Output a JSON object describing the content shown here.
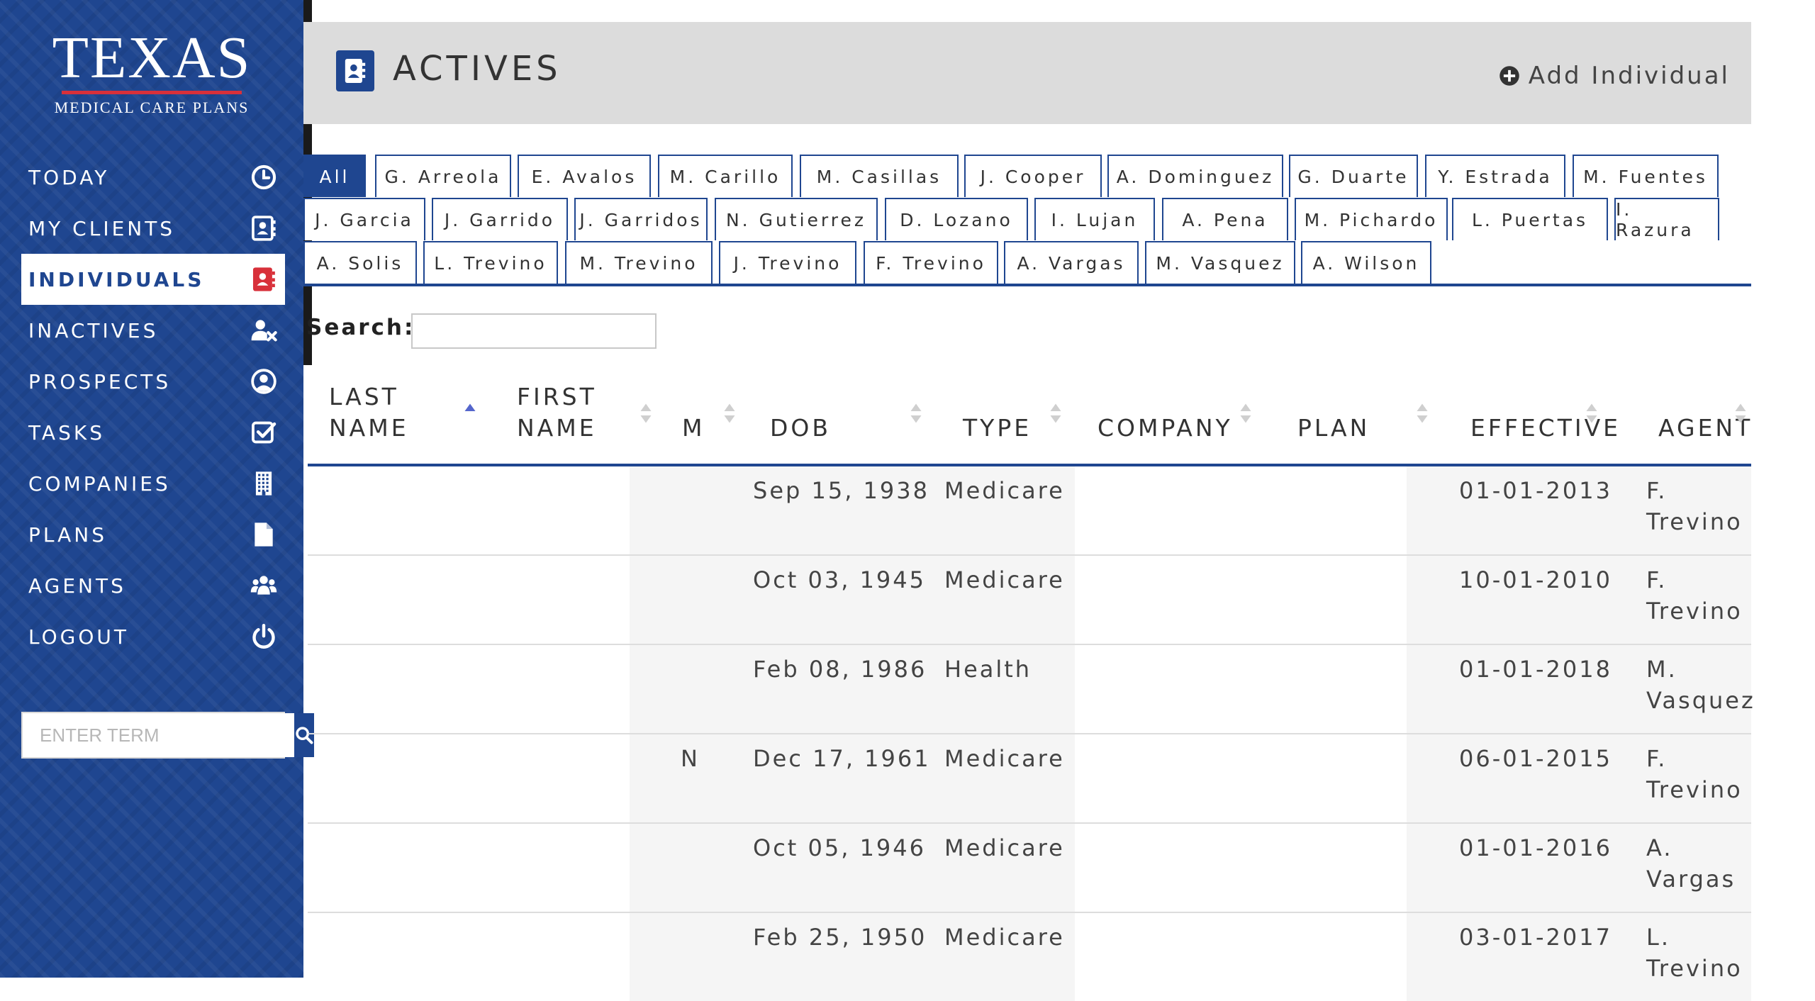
{
  "brand": {
    "name": "TEXAS",
    "subtitle": "MEDICAL CARE PLANS"
  },
  "nav": [
    {
      "label": "TODAY",
      "icon": "clock-icon",
      "active": false
    },
    {
      "label": "MY CLIENTS",
      "icon": "contact-card-icon",
      "active": false
    },
    {
      "label": "INDIVIDUALS",
      "icon": "address-book-icon",
      "active": true
    },
    {
      "label": "INACTIVES",
      "icon": "user-remove-icon",
      "active": false
    },
    {
      "label": "PROSPECTS",
      "icon": "user-circle-icon",
      "active": false
    },
    {
      "label": "TASKS",
      "icon": "checkbox-icon",
      "active": false
    },
    {
      "label": "COMPANIES",
      "icon": "building-icon",
      "active": false
    },
    {
      "label": "PLANS",
      "icon": "file-icon",
      "active": false
    },
    {
      "label": "AGENTS",
      "icon": "users-icon",
      "active": false
    },
    {
      "label": "LOGOUT",
      "icon": "power-icon",
      "active": false
    }
  ],
  "sidebar_search": {
    "placeholder": "ENTER TERM"
  },
  "header": {
    "title": "ACTIVES",
    "add_label": "Add Individual"
  },
  "tabs": [
    "All",
    "G. Arreola",
    "E. Avalos",
    "M. Carillo",
    "M. Casillas",
    "J. Cooper",
    "A. Dominguez",
    "G. Duarte",
    "Y. Estrada",
    "M. Fuentes",
    "J. Garcia",
    "J. Garrido",
    "J. Garridos",
    "N. Gutierrez",
    "D. Lozano",
    "I. Lujan",
    "A. Pena",
    "M. Pichardo",
    "L. Puertas",
    "I. Razura",
    "A. Solis",
    "L. Trevino",
    "M. Trevino",
    "J. Trevino",
    "F. Trevino",
    "A. Vargas",
    "M. Vasquez",
    "A. Wilson"
  ],
  "active_tab": "All",
  "search": {
    "label": "Search:",
    "value": ""
  },
  "table": {
    "columns": [
      {
        "key": "last",
        "line1": "LAST",
        "line2": "NAME",
        "sort": "asc"
      },
      {
        "key": "first",
        "line1": "FIRST",
        "line2": "NAME",
        "sort": "none"
      },
      {
        "key": "m",
        "line1": "",
        "line2": "M",
        "sort": "none"
      },
      {
        "key": "dob",
        "line1": "",
        "line2": "DOB",
        "sort": "none"
      },
      {
        "key": "type",
        "line1": "",
        "line2": "TYPE",
        "sort": "none"
      },
      {
        "key": "company",
        "line1": "",
        "line2": "COMPANY",
        "sort": "none"
      },
      {
        "key": "plan",
        "line1": "",
        "line2": "PLAN",
        "sort": "none"
      },
      {
        "key": "effective",
        "line1": "",
        "line2": "EFFECTIVE",
        "sort": "none"
      },
      {
        "key": "agent",
        "line1": "",
        "line2": "AGENT",
        "sort": "none"
      }
    ],
    "rows": [
      {
        "m": "",
        "dob": "Sep 15, 1938",
        "type": "Medicare",
        "effective": "01-01-2013",
        "agent1": "F.",
        "agent2": "Trevino"
      },
      {
        "m": "",
        "dob": "Oct 03, 1945",
        "type": "Medicare",
        "effective": "10-01-2010",
        "agent1": "F.",
        "agent2": "Trevino"
      },
      {
        "m": "",
        "dob": "Feb 08, 1986",
        "type": "Health",
        "effective": "01-01-2018",
        "agent1": "M.",
        "agent2": "Vasquez"
      },
      {
        "m": "N",
        "dob": "Dec 17, 1961",
        "type": "Medicare",
        "effective": "06-01-2015",
        "agent1": "F.",
        "agent2": "Trevino"
      },
      {
        "m": "",
        "dob": "Oct 05, 1946",
        "type": "Medicare",
        "effective": "01-01-2016",
        "agent1": "A.",
        "agent2": "Vargas"
      },
      {
        "m": "",
        "dob": "Feb 25, 1950",
        "type": "Medicare",
        "effective": "03-01-2017",
        "agent1": "L.",
        "agent2": "Trevino"
      }
    ]
  },
  "colors": {
    "primary": "#1f4690",
    "active_icon": "#d8303a",
    "header_bg": "#dcdcdc"
  }
}
